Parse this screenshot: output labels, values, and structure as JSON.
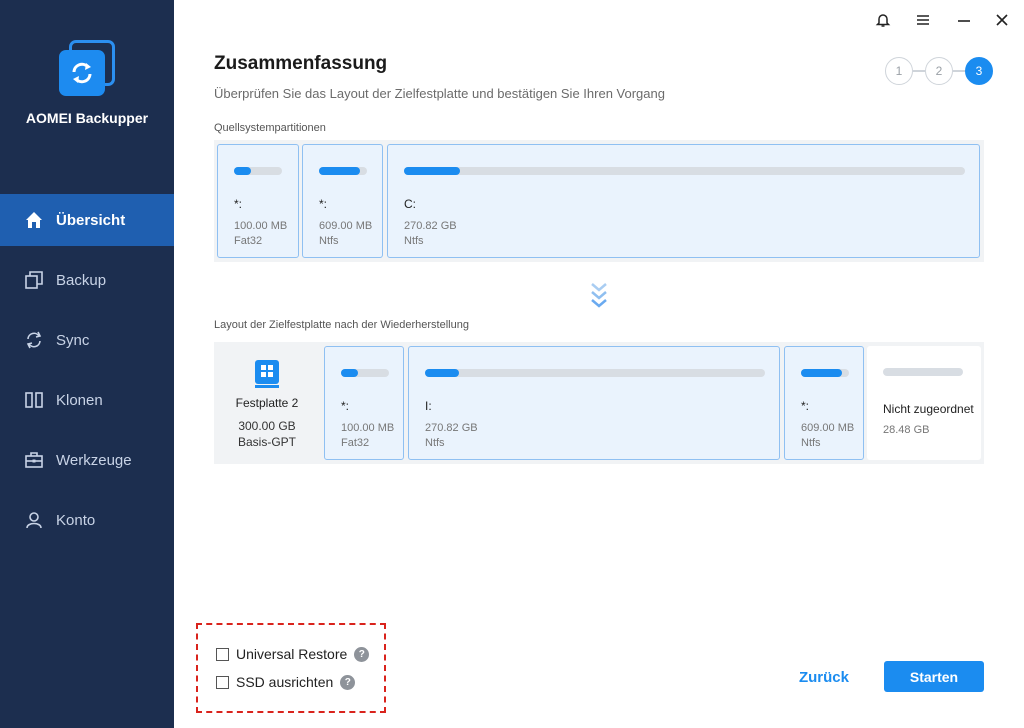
{
  "app": {
    "name": "AOMEI Backupper"
  },
  "sidebar": {
    "items": [
      {
        "label": "Übersicht",
        "icon": "home-icon",
        "active": true
      },
      {
        "label": "Backup",
        "icon": "backup-icon",
        "active": false
      },
      {
        "label": "Sync",
        "icon": "sync-icon",
        "active": false
      },
      {
        "label": "Klonen",
        "icon": "clone-icon",
        "active": false
      },
      {
        "label": "Werkzeuge",
        "icon": "toolbox-icon",
        "active": false
      },
      {
        "label": "Konto",
        "icon": "user-icon",
        "active": false
      }
    ]
  },
  "window_controls": [
    "bell-icon",
    "menu-icon",
    "minimize-icon",
    "close-icon"
  ],
  "header": {
    "title": "Zusammenfassung",
    "subtitle": "Überprüfen Sie das Layout der Zielfestplatte und bestätigen Sie Ihren Vorgang"
  },
  "steps": [
    "1",
    "2",
    "3"
  ],
  "active_step": 3,
  "source": {
    "label": "Quellsystempartitionen",
    "partitions": [
      {
        "name": "*:",
        "size": "100.00 MB",
        "fs": "Fat32",
        "used_fraction": 0.35
      },
      {
        "name": "*:",
        "size": "609.00 MB",
        "fs": "Ntfs",
        "used_fraction": 0.85
      },
      {
        "name": "C:",
        "size": "270.82 GB",
        "fs": "Ntfs",
        "used_fraction": 0.1
      }
    ]
  },
  "target": {
    "label": "Layout der Zielfestplatte nach der Wiederherstellung",
    "disk": {
      "name": "Festplatte 2",
      "size": "300.00 GB",
      "type": "Basis-GPT"
    },
    "partitions": [
      {
        "name": "*:",
        "size": "100.00 MB",
        "fs": "Fat32",
        "used_fraction": 0.35
      },
      {
        "name": "I:",
        "size": "270.82 GB",
        "fs": "Ntfs",
        "used_fraction": 0.1
      },
      {
        "name": "*:",
        "size": "609.00 MB",
        "fs": "Ntfs",
        "used_fraction": 0.85
      },
      {
        "name": "Nicht zugeordnet",
        "size": "28.48 GB",
        "fs": "",
        "used_fraction": 0
      }
    ]
  },
  "options": {
    "universal_restore": "Universal Restore",
    "ssd_align": "SSD ausrichten",
    "help_glyph": "?"
  },
  "buttons": {
    "back": "Zurück",
    "start": "Starten"
  },
  "colors": {
    "sidebar": "#1c2e4f",
    "active_nav": "#1f5fb0",
    "accent": "#1b8cf0",
    "highlight_box": "#d9231c"
  }
}
